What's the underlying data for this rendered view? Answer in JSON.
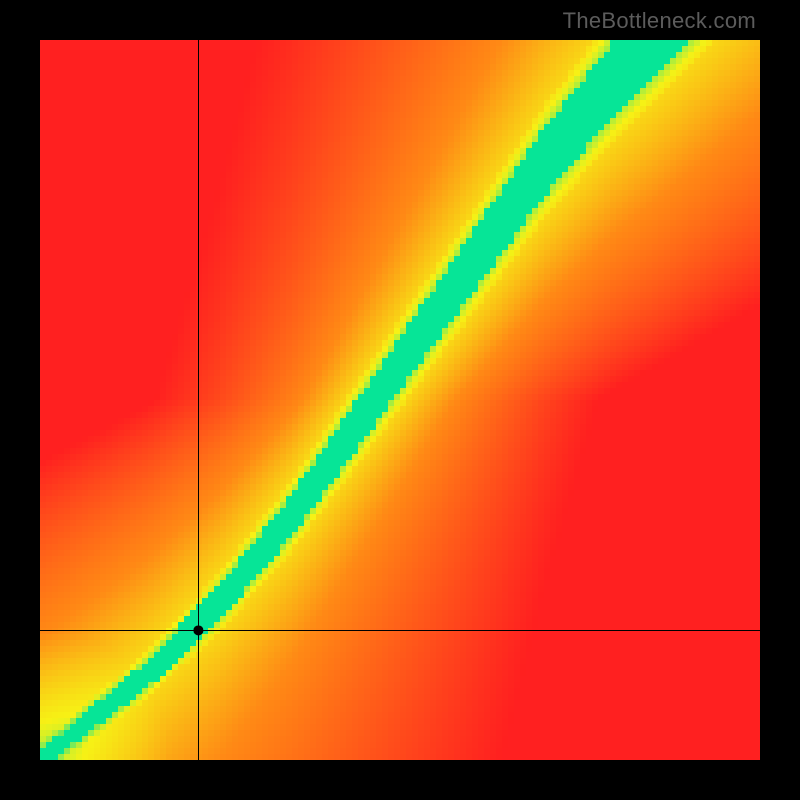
{
  "watermark": "TheBottleneck.com",
  "chart_data": {
    "type": "heatmap",
    "title": "",
    "xlabel": "",
    "ylabel": "",
    "xlim": [
      0,
      100
    ],
    "ylim": [
      0,
      100
    ],
    "grid_cells": 120,
    "pixelated": true,
    "crosshair": {
      "x": 22,
      "y": 18
    },
    "marker": {
      "x": 22,
      "y": 18,
      "radius_px": 5
    },
    "optimal_curve": {
      "description": "center of green band; values give target y for each x",
      "points": [
        {
          "x": 0,
          "y": 0
        },
        {
          "x": 5,
          "y": 4
        },
        {
          "x": 10,
          "y": 8
        },
        {
          "x": 15,
          "y": 12
        },
        {
          "x": 20,
          "y": 17
        },
        {
          "x": 25,
          "y": 22
        },
        {
          "x": 30,
          "y": 28
        },
        {
          "x": 35,
          "y": 34
        },
        {
          "x": 40,
          "y": 41
        },
        {
          "x": 45,
          "y": 48
        },
        {
          "x": 50,
          "y": 55
        },
        {
          "x": 55,
          "y": 62
        },
        {
          "x": 60,
          "y": 69
        },
        {
          "x": 65,
          "y": 76
        },
        {
          "x": 70,
          "y": 83
        },
        {
          "x": 75,
          "y": 89
        },
        {
          "x": 80,
          "y": 95
        },
        {
          "x": 85,
          "y": 100
        }
      ]
    },
    "band": {
      "half_width_lo": 1.2,
      "half_width_hi": 5.5,
      "yellow_extra_lo": 0.8,
      "yellow_extra_hi": 3.5
    },
    "palette": {
      "green": "#06e597",
      "yellow": "#f7f215",
      "orange": "#ff8a15",
      "red": "#ff2020"
    }
  }
}
